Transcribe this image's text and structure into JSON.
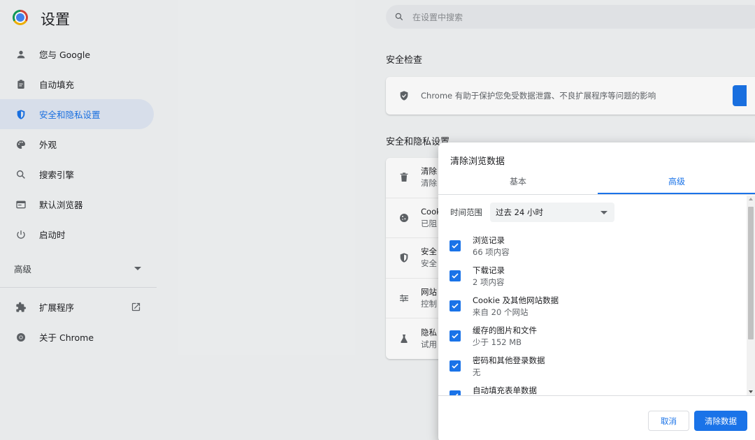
{
  "app": {
    "title": "设置"
  },
  "search": {
    "placeholder": "在设置中搜索"
  },
  "sidebar": {
    "items": [
      {
        "label": "您与 Google"
      },
      {
        "label": "自动填充"
      },
      {
        "label": "安全和隐私设置"
      },
      {
        "label": "外观"
      },
      {
        "label": "搜索引擎"
      },
      {
        "label": "默认浏览器"
      },
      {
        "label": "启动时"
      }
    ],
    "advanced_label": "高级",
    "extensions_label": "扩展程序",
    "about_label": "关于 Chrome"
  },
  "main": {
    "safety_check_title": "安全检查",
    "safety_check_text": "Chrome 有助于保护您免受数据泄露、不良扩展程序等问题的影响",
    "privacy_title": "安全和隐私设置",
    "privacy_rows": [
      {
        "title": "清除",
        "sub": "清除"
      },
      {
        "title": "Cook",
        "sub": "已阻"
      },
      {
        "title": "安全",
        "sub": "安全"
      },
      {
        "title": "网站",
        "sub": "控制"
      },
      {
        "title": "隐私",
        "sub": "试用"
      }
    ]
  },
  "dialog": {
    "title": "清除浏览数据",
    "tabs": [
      "基本",
      "高级"
    ],
    "active_tab": "高级",
    "time_range_label": "时间范围",
    "time_range_value": "过去 24 小时",
    "items": [
      {
        "label": "浏览记录",
        "sub": "66 项内容",
        "checked": true
      },
      {
        "label": "下载记录",
        "sub": "2 项内容",
        "checked": true
      },
      {
        "label": "Cookie 及其他网站数据",
        "sub": "来自 20 个网站",
        "checked": true
      },
      {
        "label": "缓存的图片和文件",
        "sub": "少于 152 MB",
        "checked": true
      },
      {
        "label": "密码和其他登录数据",
        "sub": "无",
        "checked": true
      },
      {
        "label": "自动填充表单数据",
        "sub": "",
        "checked": true
      }
    ],
    "cancel_label": "取消",
    "confirm_label": "清除数据"
  },
  "colors": {
    "accent": "#1a73e8",
    "active_nav_bg": "#dfe6f3"
  }
}
